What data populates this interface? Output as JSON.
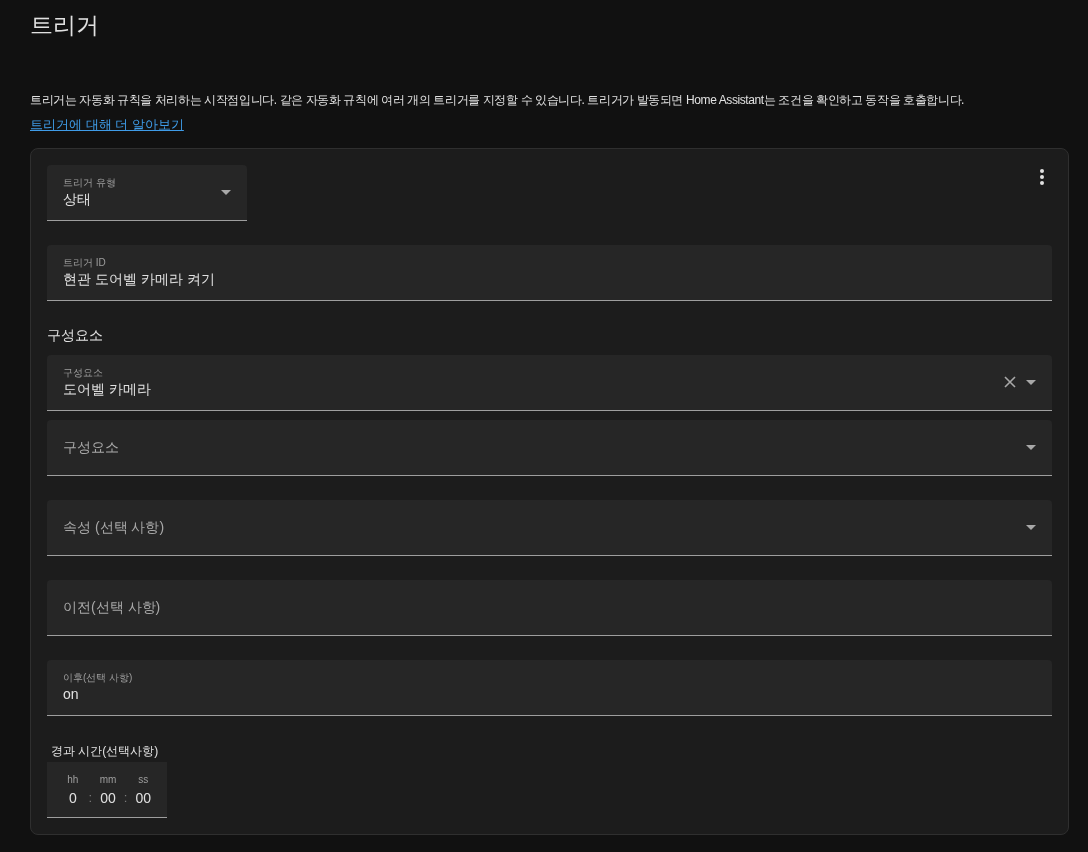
{
  "title": "트리거",
  "description": "트리거는 자동화 규칙을 처리하는 시작점입니다. 같은 자동화 규칙에 여러 개의 트리거를 지정할 수 있습니다. 트리거가 발동되면 Home Assistant는 조건을 확인하고 동작을 호출합니다.",
  "learn_more_link": "트리거에 대해 더 알아보기",
  "trigger_card": {
    "type_field": {
      "kind": "select",
      "label": "트리거 유형",
      "value": "상태"
    },
    "fields": [
      {
        "kind": "text",
        "label": "트리거 ID",
        "value": "현관 도어벨 카메라 켜기"
      },
      {
        "kind": "section",
        "text": "구성요소"
      },
      {
        "kind": "select",
        "label": "구성요소",
        "value": "도어벨 카메라",
        "clearable": true
      },
      {
        "kind": "select",
        "placeholder": "구성요소"
      },
      {
        "kind": "select",
        "placeholder": "속성 (선택 사항)"
      },
      {
        "kind": "text",
        "placeholder": "이전(선택 사항)"
      },
      {
        "kind": "text",
        "label": "이후(선택 사항)",
        "value": "on"
      }
    ],
    "duration": {
      "label": "경과 시간(선택사항)",
      "units": [
        {
          "label": "hh",
          "value": "0"
        },
        {
          "label": "mm",
          "value": "00"
        },
        {
          "label": "ss",
          "value": "00"
        }
      ],
      "separators": [
        ":",
        ":"
      ]
    }
  }
}
